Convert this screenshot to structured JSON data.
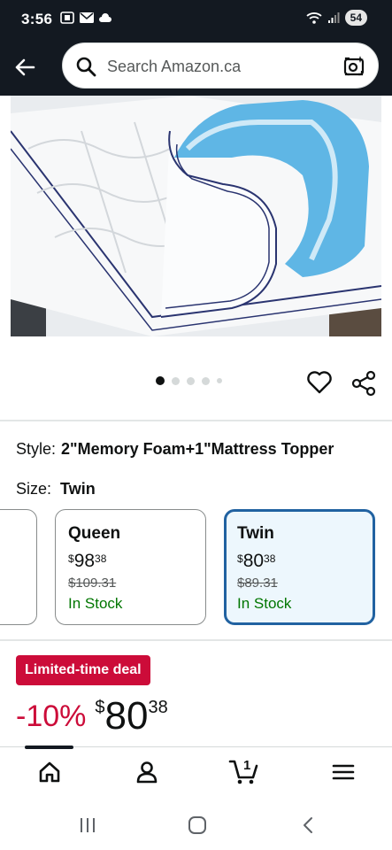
{
  "status_bar": {
    "time": "3:56",
    "battery": "54"
  },
  "search": {
    "placeholder": "Search Amazon.ca"
  },
  "gallery": {
    "dot_count": 5,
    "active_index": 0
  },
  "product": {
    "style_label": "Style:",
    "style_value": "2\"Memory Foam+1\"Mattress Topper",
    "size_label": "Size:",
    "size_value": "Twin"
  },
  "size_options": [
    {
      "name": "Queen",
      "price_currency": "$",
      "price_whole": "98",
      "price_fraction": "38",
      "old_price": "$109.31",
      "stock": "In Stock",
      "selected": false
    },
    {
      "name": "Twin",
      "price_currency": "$",
      "price_whole": "80",
      "price_fraction": "38",
      "old_price": "$89.31",
      "stock": "In Stock",
      "selected": true
    }
  ],
  "deal": {
    "badge": "Limited-time deal",
    "discount": "-10%",
    "price_currency": "$",
    "price_whole": "80",
    "price_fraction": "38"
  },
  "bottom_nav": {
    "cart_count": "1",
    "items": [
      "home-icon",
      "account-icon",
      "cart-icon",
      "menu-icon"
    ]
  },
  "colors": {
    "header_bg": "#131921",
    "deal_red": "#cc0c39",
    "in_stock_green": "#007600",
    "selected_border": "#2162a1",
    "selected_bg": "#edf7fd"
  }
}
